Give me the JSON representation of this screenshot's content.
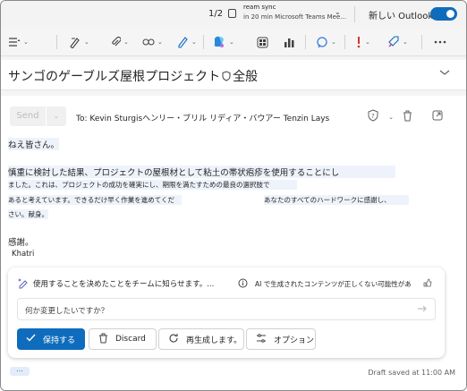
{
  "reminder": {
    "pager": "1/2",
    "title": "ream sync",
    "subtitle": "in 20 min Microsoft Teams Mee..."
  },
  "toggle": {
    "label": "新しい Outlook",
    "on": true
  },
  "colors": {
    "accent": "#0f6cbd",
    "highlight": "#eef3fb"
  },
  "ribbon": {
    "icons": [
      "format-icon",
      "brush-icon",
      "attach-icon",
      "link-icon",
      "draw-icon",
      "copilot-icon",
      "apps-icon",
      "chart-icon",
      "loop-icon",
      "importance-icon",
      "tag-icon",
      "more-icon"
    ]
  },
  "subject": {
    "text_before": "サンゴのゲーブルズ屋根プロジェクト",
    "text_after": "全般"
  },
  "compose": {
    "send": "Send",
    "to": "To: Kevin Sturgisヘンリー・ブリル リディア・バウアー Tenzin Lays",
    "greeting": "ねえ皆さん。",
    "para1_line1": "慎重に検討した結果、プロジェクトの屋根材として粘土の帯状疱疹を使用することにし",
    "para1_line2": "ました。これは、プロジェクトの成功を確実にし、期限を満たすための最良の選択肢で",
    "para1_line3a": "あると考えています。できるだけ早く作業を進めてくだ",
    "para1_line3b": "あなたのすべてのハードワークに感謝し、",
    "para1_line4": "さい。献身。",
    "thanks": "感謝。",
    "signature": "Khatri"
  },
  "copilot": {
    "prompt": "使用することを決めたことをチームに知らせます。...",
    "ai_note": "AI で生成されたコンテンツが正しくない可能性があ",
    "input_placeholder": "何か変更したいですか？",
    "keep": "保持する",
    "discard": "Discard",
    "regenerate": "再生成します。",
    "options": "オプション"
  },
  "footer": {
    "more": "...",
    "draft": "Draft saved at 11:00 AM"
  }
}
